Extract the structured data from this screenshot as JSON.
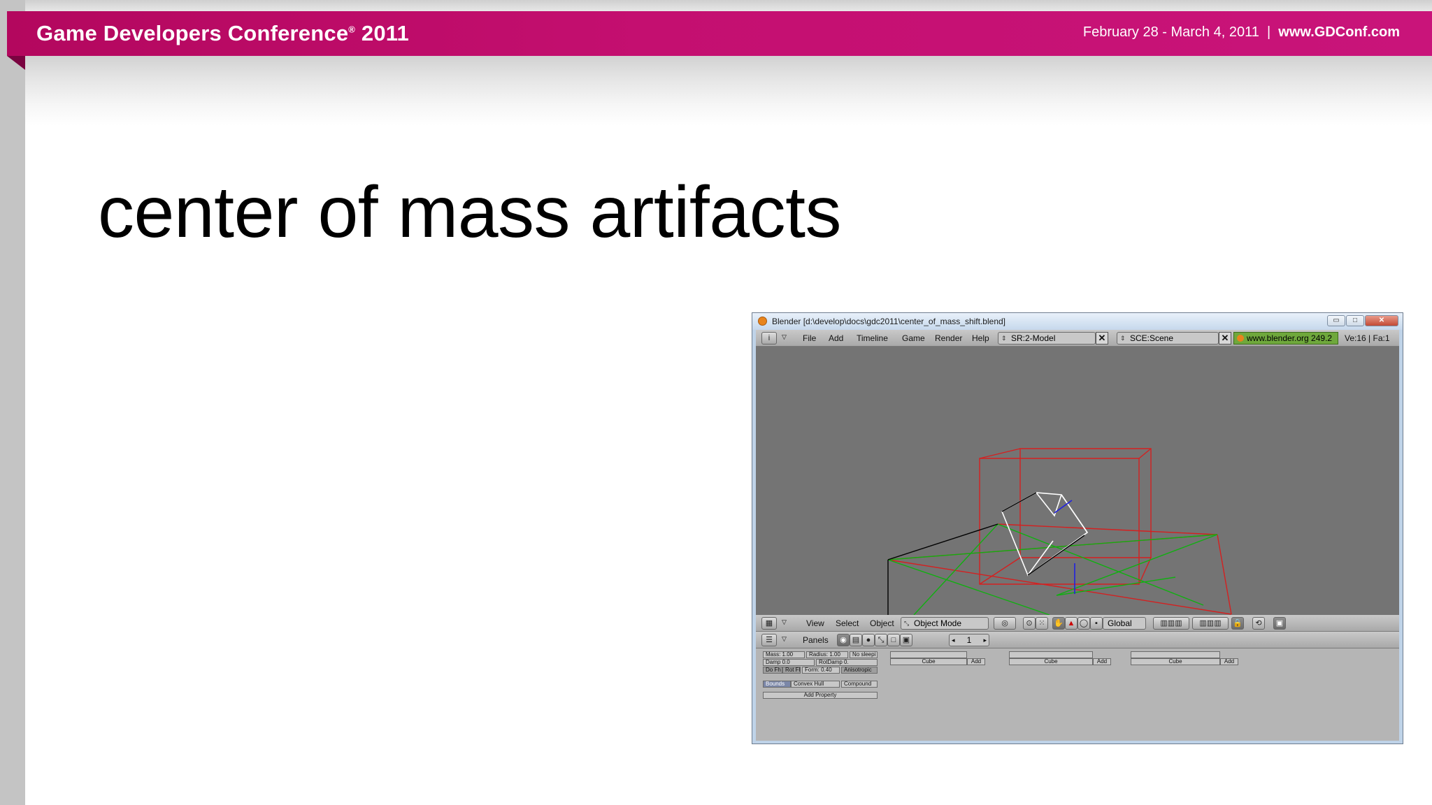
{
  "banner": {
    "title": "Game Developers Conference",
    "reg": "®",
    "year": "2011",
    "dates": "February 28 - March 4, 2011",
    "separator": "|",
    "url": "www.GDConf.com",
    "color": "#c40f70"
  },
  "slide": {
    "title": "center of mass artifacts"
  },
  "blender": {
    "window_title": "Blender [d:\\develop\\docs\\gdc2011\\center_of_mass_shift.blend]",
    "window_buttons": [
      "minimize-icon",
      "maximize-icon",
      "close-icon"
    ],
    "menu": [
      "File",
      "Add",
      "Timeline",
      "Game",
      "Render",
      "Help"
    ],
    "screen": "SR:2-Model",
    "scene": "SCE:Scene",
    "site": "www.blender.org 249.2",
    "stats": "Ve:16 | Fa:1",
    "view_header": {
      "items": [
        "View",
        "Select",
        "Object"
      ],
      "mode": "Object Mode",
      "orientation": "Global"
    },
    "buttons_header": {
      "label": "Panels",
      "frame": "1"
    },
    "physics": {
      "mass": "Mass: 1.00",
      "radius": "Radius: 1.00",
      "no_sleep": "No sleepi",
      "damp": "Damp 0.0",
      "rotdamp": "RotDamp 0.",
      "do_fh": "Do Fh",
      "rot_fh": "Rot Fh",
      "form": "Form: 0.40",
      "anisotropic": "Anisotropic",
      "bounds": "Bounds",
      "convex_hull": "Convex Hull",
      "compound": "Compound",
      "add_property": "Add Property"
    },
    "logic_columns": [
      {
        "object": "Cube",
        "add": "Add"
      },
      {
        "object": "Cube",
        "add": "Add"
      },
      {
        "object": "Cube",
        "add": "Add"
      }
    ],
    "colors": {
      "viewport": "#747474",
      "header": "#b5b5b5",
      "info": "#6fa83c"
    }
  }
}
